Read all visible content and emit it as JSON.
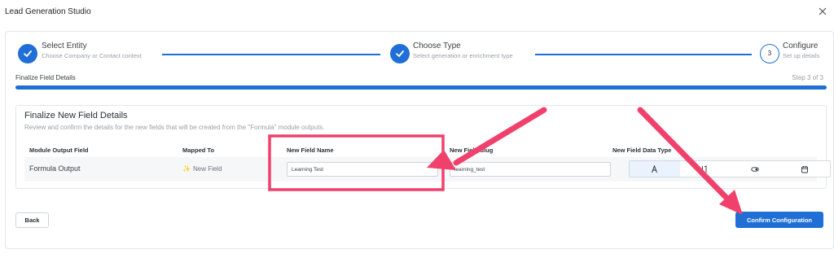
{
  "window": {
    "title": "Lead Generation Studio"
  },
  "stepper": {
    "steps": [
      {
        "title": "Select Entity",
        "subtitle": "Choose Company or Contact context",
        "state": "complete"
      },
      {
        "title": "Choose Type",
        "subtitle": "Select generation or enrichment type",
        "state": "complete"
      },
      {
        "title": "Configure",
        "subtitle": "Set up details",
        "state": "current",
        "number": "3"
      }
    ]
  },
  "progress": {
    "label": "Finalize Field Details",
    "step_text": "Step 3 of 3",
    "fraction": 1.0
  },
  "card": {
    "title": "Finalize New Field Details",
    "description": "Review and confirm the details for the new fields that will be created from the \"Formula\" module outputs.",
    "columns": [
      "Module Output Field",
      "Mapped To",
      "New Field Name",
      "New Field Slug",
      "New Field Data Type"
    ],
    "rows": [
      {
        "output_field": "Formula Output",
        "mapped_to": "New Field",
        "mapped_icon": "sparkle-icon",
        "field_name": "Learning Test",
        "field_slug": "learning_test",
        "data_types": [
          "text-type-icon",
          "number-type-icon",
          "boolean-type-icon",
          "date-type-icon"
        ],
        "selected_type": "text-type-icon"
      }
    ]
  },
  "buttons": {
    "back": "Back",
    "confirm": "Confirm Configuration"
  },
  "colors": {
    "accent": "#1f6fd6",
    "annotation": "#f0416c"
  }
}
